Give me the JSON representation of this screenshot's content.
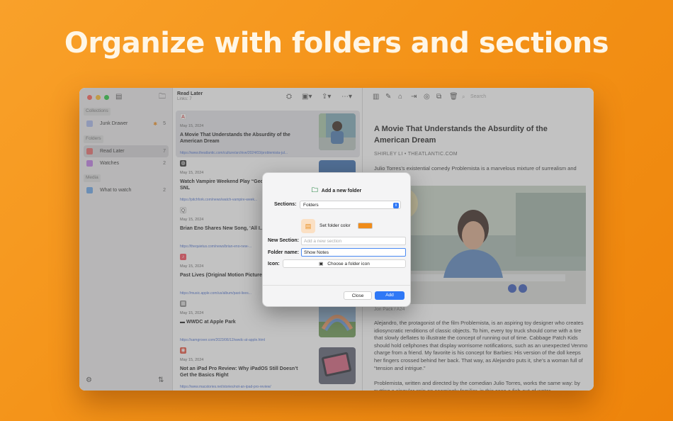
{
  "headline": "Organize with folders and sections",
  "colors": {
    "accent": "#2f78f6",
    "folder_color": "#f08c1a",
    "background": "#f39116"
  },
  "sidebar": {
    "sections": [
      "Collections",
      "Folders",
      "Media"
    ],
    "items": [
      {
        "label": "Junk Drawer",
        "count": "5",
        "icon": "tray-icon"
      },
      {
        "label": "Read Later",
        "count": "7",
        "icon": "folder-icon"
      },
      {
        "label": "Watches",
        "count": "2",
        "icon": "folder-icon"
      },
      {
        "label": "What to watch",
        "count": "2",
        "icon": "folder-icon"
      }
    ]
  },
  "list": {
    "title": "Read Later",
    "subtitle": "Links: 7",
    "cards": [
      {
        "date": "May 15, 2024",
        "title": "A Movie That Understands the Absurdity of the American Dream",
        "url": "https://www.theatlantic.com/culture/archive/2024/03/problemista-jul..."
      },
      {
        "date": "May 15, 2024",
        "title": "Watch Vampire Weekend Play “Ged... “Capricorn” on SNL",
        "url": "https://pitchfork.com/news/watch-vampire-week..."
      },
      {
        "date": "May 15, 2024",
        "title": "Brian Eno Shares New Song, ‘All I...",
        "url": "https://thequietus.com/news/brian-eno-new-..."
      },
      {
        "date": "May 15, 2024",
        "title": "Past Lives (Original Motion Picture...",
        "url": "https://music.apple.com/us/album/past-lives..."
      },
      {
        "date": "May 15, 2024",
        "title": "WWDC at Apple Park",
        "url": "https://samgrover.com/2023/06/12/wwdc-at-apple.html"
      },
      {
        "date": "May 15, 2024",
        "title": "Not an iPad Pro Review: Why iPadOS Still Doesn’t Get the Basics Right",
        "url": "https://www.macstories.net/stories/not-an-ipad-pro-review/"
      }
    ]
  },
  "detail": {
    "search_placeholder": "Search",
    "title": "A Movie That Understands the Absurdity of the American Dream",
    "byline": "SHIRLEY LI • THEATLANTIC.COM",
    "dek": "Julio Torres’s existential comedy Problemista is a marvelous mixture of surrealism and",
    "credit": "Jon Pack / A24",
    "body": "Alejandro, the protagonist of the film Problemista, is an aspiring toy designer who creates idiosyncratic renditions of classic objects. To him, every toy truck should come with a tire that slowly deflates to illustrate the concept of running out of time. Cabbage Patch Kids should hold cellphones that display worrisome notifications, such as an unexpected Venmo charge from a friend. My favorite is his concept for Barbies: His version of the doll keeps her fingers crossed behind her back. That way, as Alejandro puts it, she’s a woman full of “tension and intrigue.”",
    "body2": "Problemista, written and directed by the comedian Julio Torres, works the same way: by putting a singular spin on seemingly familiar, in this case a fish-out-of-water"
  },
  "dialog": {
    "title": "Add a new folder",
    "sections_label": "Sections:",
    "sections_value": "Folders",
    "set_color_label": "Set folder color",
    "new_section_label": "New Section:",
    "new_section_placeholder": "Add a new section",
    "folder_name_label": "Folder name:",
    "folder_name_value": "Show Notes",
    "icon_label": "Icon:",
    "choose_icon_label": "Choose a folder icon",
    "close_label": "Close",
    "add_label": "Add"
  }
}
